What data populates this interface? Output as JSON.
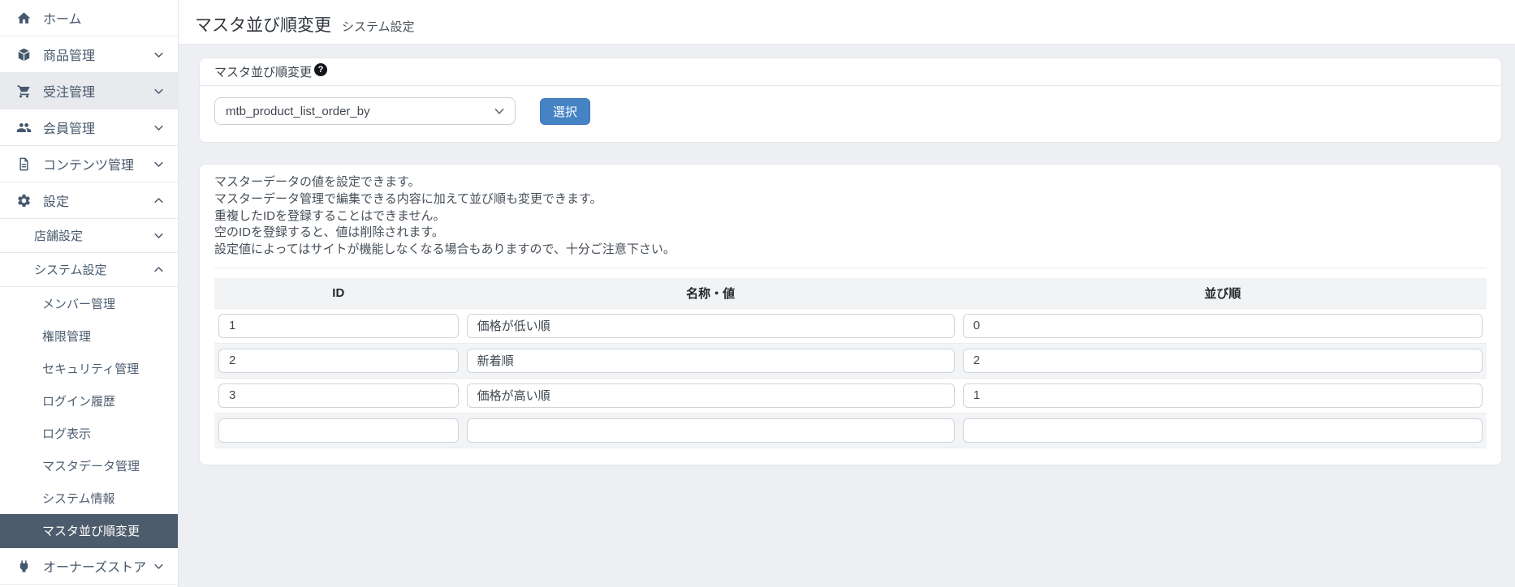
{
  "sidebar": {
    "items": [
      {
        "label": "ホーム"
      },
      {
        "label": "商品管理"
      },
      {
        "label": "受注管理"
      },
      {
        "label": "会員管理"
      },
      {
        "label": "コンテンツ管理"
      },
      {
        "label": "設定"
      },
      {
        "label": "店舗設定"
      },
      {
        "label": "システム設定"
      },
      {
        "label": "メンバー管理"
      },
      {
        "label": "権限管理"
      },
      {
        "label": "セキュリティ管理"
      },
      {
        "label": "ログイン履歴"
      },
      {
        "label": "ログ表示"
      },
      {
        "label": "マスタデータ管理"
      },
      {
        "label": "システム情報"
      },
      {
        "label": "マスタ並び順変更"
      },
      {
        "label": "オーナーズストア"
      }
    ]
  },
  "header": {
    "title": "マスタ並び順変更",
    "subtitle": "システム設定"
  },
  "selector_card": {
    "heading": "マスタ並び順変更",
    "help_label": "?",
    "select_value": "mtb_product_list_order_by",
    "button_label": "選択"
  },
  "editor_card": {
    "description_lines": [
      "マスターデータの値を設定できます。",
      "マスターデータ管理で編集できる内容に加えて並び順も変更できます。",
      "重複したIDを登録することはできません。",
      "空のIDを登録すると、値は削除されます。",
      "設定値によってはサイトが機能しなくなる場合もありますので、十分ご注意下さい。"
    ],
    "table": {
      "columns": [
        "ID",
        "名称・値",
        "並び順"
      ],
      "rows": [
        {
          "id": "1",
          "name": "価格が低い順",
          "sort": "0"
        },
        {
          "id": "2",
          "name": "新着順",
          "sort": "2"
        },
        {
          "id": "3",
          "name": "価格が高い順",
          "sort": "1"
        },
        {
          "id": "",
          "name": "",
          "sort": ""
        }
      ]
    }
  },
  "colors": {
    "accent_blue": "#4583c5",
    "sidebar_active_bg": "#4d5c6c",
    "content_bg": "#edeff2",
    "help_icon_bg": "#111418"
  }
}
